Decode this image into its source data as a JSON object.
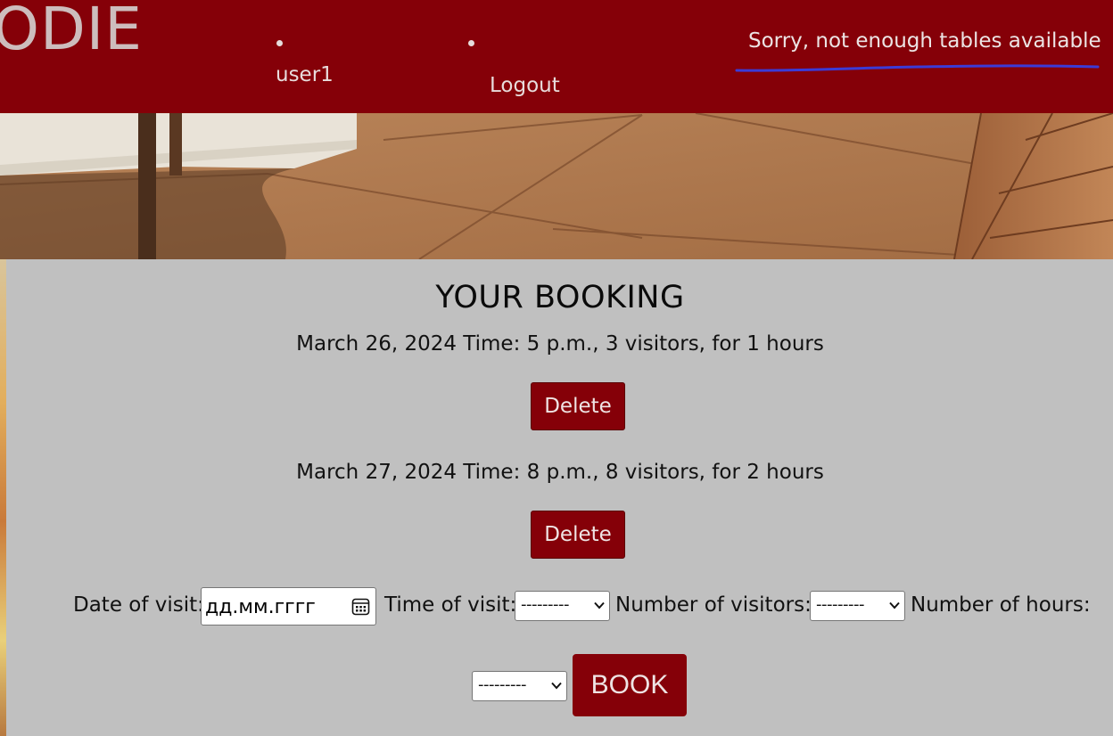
{
  "header": {
    "logo_text": "ODIE",
    "nav": [
      {
        "label": "user1"
      },
      {
        "label": "Logout"
      }
    ],
    "error_message": "Sorry, not enough tables available"
  },
  "main": {
    "title": "YOUR BOOKING",
    "bookings": [
      {
        "text": "March 26, 2024 Time: 5 p.m., 3 visitors, for 1 hours",
        "delete_label": "Delete"
      },
      {
        "text": "March 27, 2024 Time: 8 p.m., 8 visitors, for 2 hours",
        "delete_label": "Delete"
      }
    ],
    "form": {
      "date_label": "Date of visit:",
      "date_placeholder": "дд.мм.гггг",
      "time_label": "Time of visit:",
      "time_value": "---------",
      "visitors_label": "Number of visitors:",
      "visitors_value": "---------",
      "hours_label": "Number of hours:",
      "hours_value": "---------",
      "book_label": "BOOK"
    }
  },
  "colors": {
    "brand": "#850008",
    "background": "#c0c0c0",
    "error_underline": "#3b3bd6"
  }
}
